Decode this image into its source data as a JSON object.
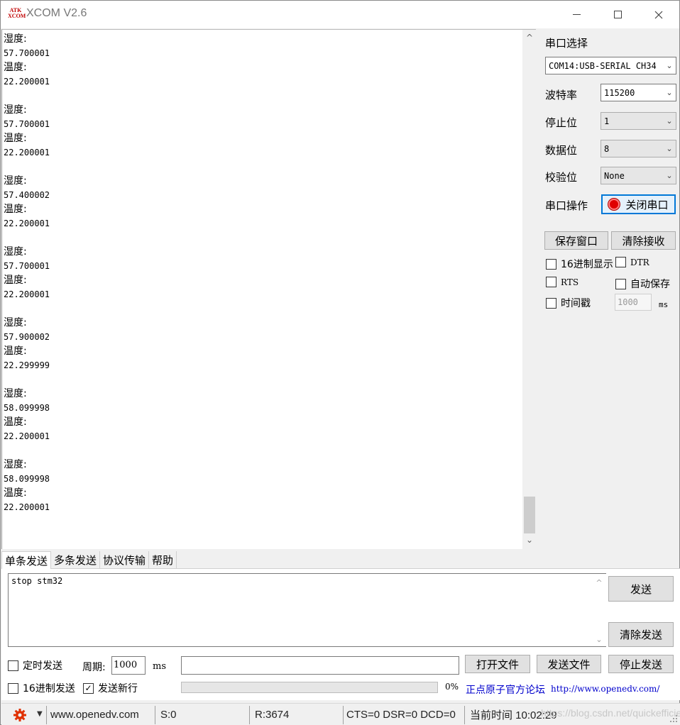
{
  "window": {
    "logo_text": "ATK XCOM",
    "title": "XCOM V2.6"
  },
  "receive": {
    "lines": [
      "湿度:",
      "57.700001",
      "温度:",
      "22.200001",
      "",
      "湿度:",
      "57.700001",
      "温度:",
      "22.200001",
      "",
      "湿度:",
      "57.400002",
      "温度:",
      "22.200001",
      "",
      "湿度:",
      "57.700001",
      "温度:",
      "22.200001",
      "",
      "湿度:",
      "57.900002",
      "温度:",
      "22.299999",
      "",
      "湿度:",
      "58.099998",
      "温度:",
      "22.200001",
      "",
      "湿度:",
      "58.099998",
      "温度:",
      "22.200001"
    ]
  },
  "serial": {
    "port_label": "串口选择",
    "port_value": "COM14:USB-SERIAL CH34",
    "baud_label": "波特率",
    "baud_value": "115200",
    "stop_label": "停止位",
    "stop_value": "1",
    "data_label": "数据位",
    "data_value": "8",
    "parity_label": "校验位",
    "parity_value": "None",
    "op_label": "串口操作",
    "close_port": "关闭串口"
  },
  "actions": {
    "save_window": "保存窗口",
    "clear_receive": "清除接收"
  },
  "options": {
    "hex_display": "16进制显示",
    "dtr": "DTR",
    "rts": "RTS",
    "auto_save": "自动保存",
    "timestamp": "时间戳",
    "timestamp_value": "1000",
    "timestamp_unit": "ms"
  },
  "tabs": [
    "单条发送",
    "多条发送",
    "协议传输",
    "帮助"
  ],
  "send": {
    "text": "stop stm32",
    "send_button": "发送",
    "clear_send": "清除发送",
    "timed_send": "定时发送",
    "period_label": "周期:",
    "period_value": "1000",
    "period_unit": "ms",
    "open_file": "打开文件",
    "send_file": "发送文件",
    "stop_send": "停止发送",
    "hex_send": "16进制发送",
    "send_newline": "发送新行",
    "send_newline_checked": true,
    "progress_pct": "0%",
    "progress_value": 0,
    "forum_label": "正点原子官方论坛",
    "forum_url": "http://www.openedv.com/"
  },
  "status": {
    "website": "www.openedv.com",
    "sent": "S:0",
    "received": "R:3674",
    "lines": "CTS=0 DSR=0 DCD=0",
    "time": "当前时间 10:02:29",
    "watermark": "https://blog.csdn.net/quickefficient"
  },
  "colors": {
    "accent": "#0078d7",
    "led": "#e00000",
    "link": "#0000cc",
    "settings_icon": "#e03000"
  }
}
